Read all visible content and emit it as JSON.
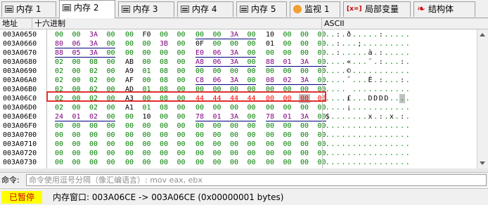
{
  "tabs": [
    {
      "label": "内存 1",
      "icon": "memory-icon"
    },
    {
      "label": "内存 2",
      "icon": "memory-icon",
      "active": true
    },
    {
      "label": "内存 3",
      "icon": "memory-icon"
    },
    {
      "label": "内存 4",
      "icon": "memory-icon"
    },
    {
      "label": "内存 5",
      "icon": "memory-icon"
    },
    {
      "label": "监视 1",
      "icon": "watch-icon"
    },
    {
      "label": "局部变量",
      "icon": "local-variable-icon",
      "prefix": "[x=]"
    },
    {
      "label": "结构体",
      "icon": "struct-icon"
    }
  ],
  "columns": {
    "address": "地址",
    "hex": "十六进制",
    "ascii": "ASCII"
  },
  "colors": {
    "green": "#008000",
    "purple": "#800080",
    "blue": "#000080",
    "red": "#ff0000",
    "black": "#000000",
    "underline": "#000080",
    "highlight_border": "#e03030",
    "selected_bg": "#c0c0c0"
  },
  "rows": [
    {
      "address": "003A0650",
      "bytes": [
        "00",
        "00",
        "3A",
        "00",
        "00",
        "F0",
        "00",
        "00",
        "00",
        "00",
        "3A",
        "00",
        "10",
        "00",
        "00",
        "00"
      ],
      "ascii": "..:.ð.....:.....",
      "colors": [
        "green",
        "green",
        "purple",
        "green",
        "green",
        "black",
        "green",
        "green",
        "green",
        "green",
        "purple",
        "green",
        "black",
        "green",
        "green",
        "green"
      ]
    },
    {
      "address": "003A0660",
      "bytes": [
        "80",
        "06",
        "3A",
        "00",
        "00",
        "00",
        "3B",
        "00",
        "0F",
        "00",
        "00",
        "00",
        "01",
        "00",
        "00",
        "00"
      ],
      "ascii": "..:...;.........",
      "colors": [
        "purple",
        "purple",
        "purple",
        "green",
        "green",
        "green",
        "purple",
        "green",
        "black",
        "green",
        "green",
        "green",
        "black",
        "green",
        "green",
        "green"
      ]
    },
    {
      "address": "003A0670",
      "bytes": [
        "88",
        "05",
        "3A",
        "00",
        "00",
        "00",
        "00",
        "00",
        "E0",
        "06",
        "3A",
        "00",
        "00",
        "00",
        "00",
        "00"
      ],
      "ascii": "..:.....à.:.....",
      "colors": [
        "purple",
        "purple",
        "purple",
        "green",
        "green",
        "green",
        "green",
        "green",
        "purple",
        "purple",
        "purple",
        "green",
        "green",
        "green",
        "green",
        "green"
      ]
    },
    {
      "address": "003A0680",
      "bytes": [
        "02",
        "00",
        "08",
        "00",
        "AB",
        "00",
        "08",
        "00",
        "A8",
        "06",
        "3A",
        "00",
        "88",
        "01",
        "3A",
        "00"
      ],
      "ascii": "....«...¨.:...:.",
      "colors": [
        "green",
        "green",
        "green",
        "green",
        "black",
        "green",
        "green",
        "green",
        "purple",
        "purple",
        "purple",
        "green",
        "purple",
        "purple",
        "purple",
        "green"
      ]
    },
    {
      "address": "003A0690",
      "bytes": [
        "02",
        "00",
        "02",
        "00",
        "A9",
        "01",
        "08",
        "00",
        "00",
        "00",
        "00",
        "00",
        "00",
        "00",
        "00",
        "00"
      ],
      "ascii": "....©...........",
      "colors": [
        "green",
        "green",
        "green",
        "green",
        "black",
        "green",
        "green",
        "green",
        "green",
        "green",
        "green",
        "green",
        "green",
        "green",
        "green",
        "green"
      ]
    },
    {
      "address": "003A06A0",
      "bytes": [
        "02",
        "00",
        "02",
        "00",
        "AF",
        "00",
        "08",
        "00",
        "C8",
        "06",
        "3A",
        "00",
        "08",
        "02",
        "3A",
        "00"
      ],
      "ascii": "....¯...È.:...:.",
      "colors": [
        "green",
        "green",
        "green",
        "green",
        "black",
        "green",
        "green",
        "green",
        "purple",
        "purple",
        "purple",
        "green",
        "purple",
        "purple",
        "purple",
        "green"
      ]
    },
    {
      "address": "003A06B0",
      "bytes": [
        "02",
        "00",
        "02",
        "00",
        "AD",
        "01",
        "08",
        "00",
        "00",
        "00",
        "00",
        "00",
        "00",
        "00",
        "00",
        "00"
      ],
      "ascii": "....­...........",
      "colors": [
        "green",
        "green",
        "green",
        "green",
        "black",
        "green",
        "green",
        "green",
        "green",
        "green",
        "green",
        "green",
        "green",
        "green",
        "green",
        "green"
      ]
    },
    {
      "address": "003A06C0",
      "bytes": [
        "02",
        "00",
        "02",
        "00",
        "A3",
        "00",
        "08",
        "00",
        "44",
        "44",
        "44",
        "44",
        "00",
        "00",
        "00",
        "00"
      ],
      "ascii": "....£...DDDD....",
      "colors": [
        "green",
        "green",
        "green",
        "green",
        "black",
        "green",
        "green",
        "green",
        "red",
        "red",
        "red",
        "red",
        "red",
        "red",
        "red",
        "red"
      ],
      "selected_byte": 14
    },
    {
      "address": "003A06D0",
      "bytes": [
        "02",
        "00",
        "02",
        "00",
        "A1",
        "01",
        "08",
        "00",
        "00",
        "00",
        "00",
        "00",
        "00",
        "00",
        "00",
        "00"
      ],
      "ascii": "....¡...........",
      "colors": [
        "green",
        "green",
        "green",
        "green",
        "black",
        "green",
        "green",
        "green",
        "green",
        "green",
        "green",
        "green",
        "green",
        "green",
        "green",
        "green"
      ]
    },
    {
      "address": "003A06E0",
      "bytes": [
        "24",
        "01",
        "02",
        "00",
        "00",
        "10",
        "00",
        "00",
        "78",
        "01",
        "3A",
        "00",
        "78",
        "01",
        "3A",
        "00"
      ],
      "ascii": "$.......x.:.x.:.",
      "colors": [
        "purple",
        "purple",
        "purple",
        "green",
        "green",
        "black",
        "green",
        "green",
        "purple",
        "purple",
        "purple",
        "green",
        "purple",
        "purple",
        "purple",
        "green"
      ]
    },
    {
      "address": "003A06F0",
      "bytes": [
        "00",
        "00",
        "00",
        "00",
        "00",
        "00",
        "00",
        "00",
        "00",
        "00",
        "00",
        "00",
        "00",
        "00",
        "00",
        "00"
      ],
      "ascii": "................",
      "colors": [
        "green",
        "green",
        "green",
        "green",
        "green",
        "green",
        "green",
        "green",
        "green",
        "green",
        "green",
        "green",
        "green",
        "green",
        "green",
        "green"
      ]
    },
    {
      "address": "003A0700",
      "bytes": [
        "00",
        "00",
        "00",
        "00",
        "00",
        "00",
        "00",
        "00",
        "00",
        "00",
        "00",
        "00",
        "00",
        "00",
        "00",
        "00"
      ],
      "ascii": "................",
      "colors": [
        "green",
        "green",
        "green",
        "green",
        "green",
        "green",
        "green",
        "green",
        "green",
        "green",
        "green",
        "green",
        "green",
        "green",
        "green",
        "green"
      ]
    },
    {
      "address": "003A0710",
      "bytes": [
        "00",
        "00",
        "00",
        "00",
        "00",
        "00",
        "00",
        "00",
        "00",
        "00",
        "00",
        "00",
        "00",
        "00",
        "00",
        "00"
      ],
      "ascii": "................",
      "colors": [
        "green",
        "green",
        "green",
        "green",
        "green",
        "green",
        "green",
        "green",
        "green",
        "green",
        "green",
        "green",
        "green",
        "green",
        "green",
        "green"
      ]
    },
    {
      "address": "003A0720",
      "bytes": [
        "00",
        "00",
        "00",
        "00",
        "00",
        "00",
        "00",
        "00",
        "00",
        "00",
        "00",
        "00",
        "00",
        "00",
        "00",
        "00"
      ],
      "ascii": "................",
      "colors": [
        "green",
        "green",
        "green",
        "green",
        "green",
        "green",
        "green",
        "green",
        "green",
        "green",
        "green",
        "green",
        "green",
        "green",
        "green",
        "green"
      ]
    },
    {
      "address": "003A0730",
      "bytes": [
        "00",
        "00",
        "00",
        "00",
        "00",
        "00",
        "00",
        "00",
        "00",
        "00",
        "00",
        "00",
        "00",
        "00",
        "00",
        "00"
      ],
      "ascii": "................",
      "colors": [
        "green",
        "green",
        "green",
        "green",
        "green",
        "green",
        "green",
        "green",
        "green",
        "green",
        "green",
        "green",
        "green",
        "green",
        "green",
        "green"
      ]
    }
  ],
  "underlines": [
    {
      "row": 0,
      "groups": [
        2
      ]
    },
    {
      "row": 1,
      "groups": [
        0
      ]
    },
    {
      "row": 2,
      "groups": [
        0,
        2
      ]
    },
    {
      "row": 3,
      "groups": [
        2,
        3
      ]
    },
    {
      "row": 5,
      "groups": [
        2,
        3
      ]
    },
    {
      "row": 9,
      "groups": [
        0,
        2,
        3
      ]
    }
  ],
  "command": {
    "label": "命令:",
    "placeholder": "命令使用逗号分隔（像汇编语言）: mov eax, ebx"
  },
  "status": {
    "paused": "已暂停",
    "text": "内存窗口: 003A06CE -> 003A06CE (0x00000001 bytes)"
  }
}
